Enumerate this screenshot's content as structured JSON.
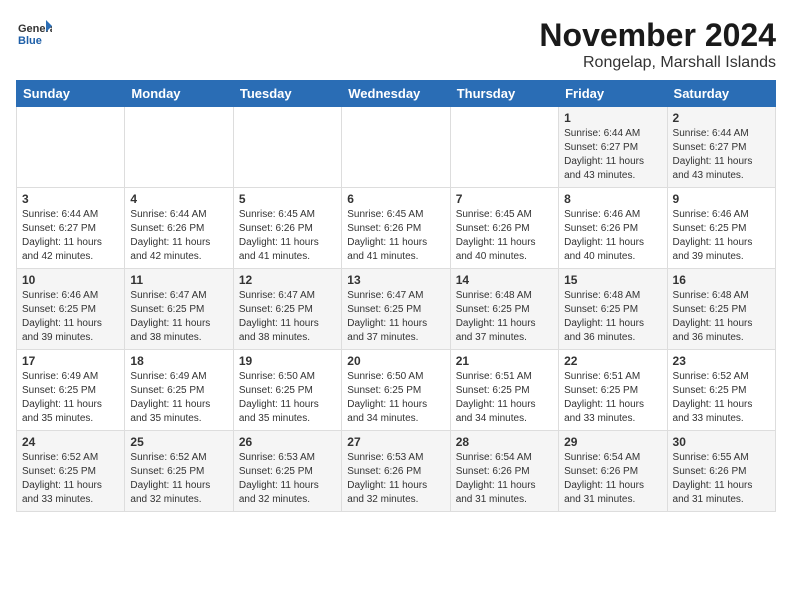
{
  "header": {
    "logo_general": "General",
    "logo_blue": "Blue",
    "month_title": "November 2024",
    "location": "Rongelap, Marshall Islands"
  },
  "weekdays": [
    "Sunday",
    "Monday",
    "Tuesday",
    "Wednesday",
    "Thursday",
    "Friday",
    "Saturday"
  ],
  "weeks": [
    [
      {
        "day": "",
        "info": ""
      },
      {
        "day": "",
        "info": ""
      },
      {
        "day": "",
        "info": ""
      },
      {
        "day": "",
        "info": ""
      },
      {
        "day": "",
        "info": ""
      },
      {
        "day": "1",
        "info": "Sunrise: 6:44 AM\nSunset: 6:27 PM\nDaylight: 11 hours\nand 43 minutes."
      },
      {
        "day": "2",
        "info": "Sunrise: 6:44 AM\nSunset: 6:27 PM\nDaylight: 11 hours\nand 43 minutes."
      }
    ],
    [
      {
        "day": "3",
        "info": "Sunrise: 6:44 AM\nSunset: 6:27 PM\nDaylight: 11 hours\nand 42 minutes."
      },
      {
        "day": "4",
        "info": "Sunrise: 6:44 AM\nSunset: 6:26 PM\nDaylight: 11 hours\nand 42 minutes."
      },
      {
        "day": "5",
        "info": "Sunrise: 6:45 AM\nSunset: 6:26 PM\nDaylight: 11 hours\nand 41 minutes."
      },
      {
        "day": "6",
        "info": "Sunrise: 6:45 AM\nSunset: 6:26 PM\nDaylight: 11 hours\nand 41 minutes."
      },
      {
        "day": "7",
        "info": "Sunrise: 6:45 AM\nSunset: 6:26 PM\nDaylight: 11 hours\nand 40 minutes."
      },
      {
        "day": "8",
        "info": "Sunrise: 6:46 AM\nSunset: 6:26 PM\nDaylight: 11 hours\nand 40 minutes."
      },
      {
        "day": "9",
        "info": "Sunrise: 6:46 AM\nSunset: 6:25 PM\nDaylight: 11 hours\nand 39 minutes."
      }
    ],
    [
      {
        "day": "10",
        "info": "Sunrise: 6:46 AM\nSunset: 6:25 PM\nDaylight: 11 hours\nand 39 minutes."
      },
      {
        "day": "11",
        "info": "Sunrise: 6:47 AM\nSunset: 6:25 PM\nDaylight: 11 hours\nand 38 minutes."
      },
      {
        "day": "12",
        "info": "Sunrise: 6:47 AM\nSunset: 6:25 PM\nDaylight: 11 hours\nand 38 minutes."
      },
      {
        "day": "13",
        "info": "Sunrise: 6:47 AM\nSunset: 6:25 PM\nDaylight: 11 hours\nand 37 minutes."
      },
      {
        "day": "14",
        "info": "Sunrise: 6:48 AM\nSunset: 6:25 PM\nDaylight: 11 hours\nand 37 minutes."
      },
      {
        "day": "15",
        "info": "Sunrise: 6:48 AM\nSunset: 6:25 PM\nDaylight: 11 hours\nand 36 minutes."
      },
      {
        "day": "16",
        "info": "Sunrise: 6:48 AM\nSunset: 6:25 PM\nDaylight: 11 hours\nand 36 minutes."
      }
    ],
    [
      {
        "day": "17",
        "info": "Sunrise: 6:49 AM\nSunset: 6:25 PM\nDaylight: 11 hours\nand 35 minutes."
      },
      {
        "day": "18",
        "info": "Sunrise: 6:49 AM\nSunset: 6:25 PM\nDaylight: 11 hours\nand 35 minutes."
      },
      {
        "day": "19",
        "info": "Sunrise: 6:50 AM\nSunset: 6:25 PM\nDaylight: 11 hours\nand 35 minutes."
      },
      {
        "day": "20",
        "info": "Sunrise: 6:50 AM\nSunset: 6:25 PM\nDaylight: 11 hours\nand 34 minutes."
      },
      {
        "day": "21",
        "info": "Sunrise: 6:51 AM\nSunset: 6:25 PM\nDaylight: 11 hours\nand 34 minutes."
      },
      {
        "day": "22",
        "info": "Sunrise: 6:51 AM\nSunset: 6:25 PM\nDaylight: 11 hours\nand 33 minutes."
      },
      {
        "day": "23",
        "info": "Sunrise: 6:52 AM\nSunset: 6:25 PM\nDaylight: 11 hours\nand 33 minutes."
      }
    ],
    [
      {
        "day": "24",
        "info": "Sunrise: 6:52 AM\nSunset: 6:25 PM\nDaylight: 11 hours\nand 33 minutes."
      },
      {
        "day": "25",
        "info": "Sunrise: 6:52 AM\nSunset: 6:25 PM\nDaylight: 11 hours\nand 32 minutes."
      },
      {
        "day": "26",
        "info": "Sunrise: 6:53 AM\nSunset: 6:25 PM\nDaylight: 11 hours\nand 32 minutes."
      },
      {
        "day": "27",
        "info": "Sunrise: 6:53 AM\nSunset: 6:26 PM\nDaylight: 11 hours\nand 32 minutes."
      },
      {
        "day": "28",
        "info": "Sunrise: 6:54 AM\nSunset: 6:26 PM\nDaylight: 11 hours\nand 31 minutes."
      },
      {
        "day": "29",
        "info": "Sunrise: 6:54 AM\nSunset: 6:26 PM\nDaylight: 11 hours\nand 31 minutes."
      },
      {
        "day": "30",
        "info": "Sunrise: 6:55 AM\nSunset: 6:26 PM\nDaylight: 11 hours\nand 31 minutes."
      }
    ]
  ]
}
